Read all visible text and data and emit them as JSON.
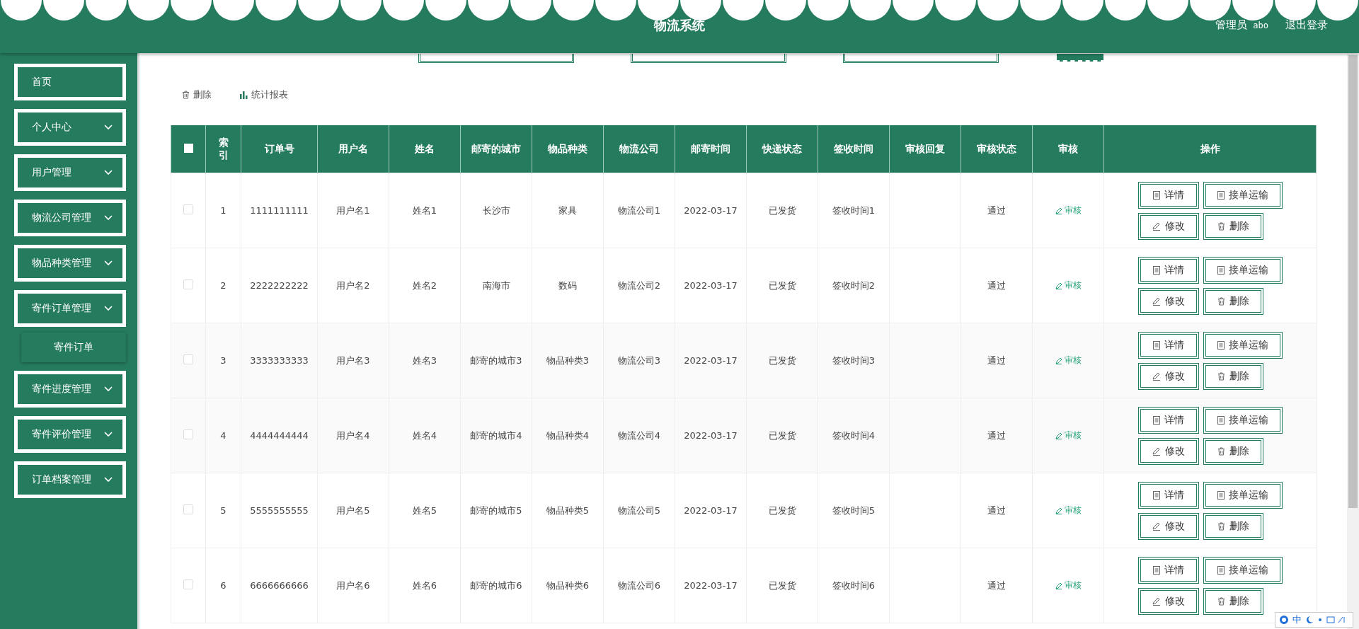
{
  "header": {
    "title": "物流系统",
    "role": "管理员",
    "username": "abo",
    "logout": "退出登录"
  },
  "sidebar": {
    "items": [
      {
        "label": "首页",
        "kind": "link"
      },
      {
        "label": "个人中心",
        "kind": "menu"
      },
      {
        "label": "用户管理",
        "kind": "menu"
      },
      {
        "label": "物流公司管理",
        "kind": "menu"
      },
      {
        "label": "物品种类管理",
        "kind": "menu"
      },
      {
        "label": "寄件订单管理",
        "kind": "menu",
        "children": [
          {
            "label": "寄件订单"
          }
        ]
      },
      {
        "label": "寄件进度管理",
        "kind": "menu"
      },
      {
        "label": "寄件评价管理",
        "kind": "menu"
      },
      {
        "label": "订单档案管理",
        "kind": "menu"
      }
    ]
  },
  "toolbar": [
    {
      "label": "删除",
      "kind": "delete"
    },
    {
      "label": "统计报表",
      "kind": "chart"
    }
  ],
  "table": {
    "select_all": {
      "checked": false
    },
    "columns": [
      "索引",
      "订单号",
      "用户名",
      "姓名",
      "邮寄的城市",
      "物品种类",
      "物流公司",
      "邮寄时间",
      "快递状态",
      "签收时间",
      "审核回复",
      "审核状态",
      "审核",
      "操作"
    ],
    "rows": [
      {
        "selected": false,
        "index": "1",
        "order_no": "1111111111",
        "username": "用户名1",
        "name": "姓名1",
        "city": "长沙市",
        "category": "家具",
        "company": "物流公司1",
        "time": "2022-03-17",
        "status": "已发货",
        "sign_time": "签收时间1",
        "review_status": "通过",
        "review_link": "审核",
        "actions": [
          {
            "label": "详情",
            "kind": "doc"
          },
          {
            "label": "接单运输",
            "kind": "doc"
          },
          {
            "label": "修改",
            "kind": "edit"
          },
          {
            "label": "删除",
            "kind": "delete"
          }
        ]
      },
      {
        "selected": false,
        "index": "2",
        "order_no": "2222222222",
        "username": "用户名2",
        "name": "姓名2",
        "city": "南海市",
        "category": "数码",
        "company": "物流公司2",
        "time": "2022-03-17",
        "status": "已发货",
        "sign_time": "签收时间2",
        "review_status": "通过",
        "review_link": "审核",
        "actions": [
          {
            "label": "详情",
            "kind": "doc"
          },
          {
            "label": "接单运输",
            "kind": "doc"
          },
          {
            "label": "修改",
            "kind": "edit"
          },
          {
            "label": "删除",
            "kind": "delete"
          }
        ]
      },
      {
        "selected": false,
        "index": "3",
        "order_no": "3333333333",
        "username": "用户名3",
        "name": "姓名3",
        "city": "邮寄的城市3",
        "category": "物品种类3",
        "company": "物流公司3",
        "time": "2022-03-17",
        "status": "已发货",
        "sign_time": "签收时间3",
        "review_status": "通过",
        "review_link": "审核",
        "actions": [
          {
            "label": "详情",
            "kind": "doc"
          },
          {
            "label": "接单运输",
            "kind": "doc"
          },
          {
            "label": "修改",
            "kind": "edit"
          },
          {
            "label": "删除",
            "kind": "delete"
          }
        ]
      },
      {
        "selected": false,
        "index": "4",
        "order_no": "4444444444",
        "username": "用户名4",
        "name": "姓名4",
        "city": "邮寄的城市4",
        "category": "物品种类4",
        "company": "物流公司4",
        "time": "2022-03-17",
        "status": "已发货",
        "sign_time": "签收时间4",
        "review_status": "通过",
        "review_link": "审核",
        "actions": [
          {
            "label": "详情",
            "kind": "doc"
          },
          {
            "label": "接单运输",
            "kind": "doc"
          },
          {
            "label": "修改",
            "kind": "edit"
          },
          {
            "label": "删除",
            "kind": "delete"
          }
        ]
      },
      {
        "selected": false,
        "index": "5",
        "order_no": "5555555555",
        "username": "用户名5",
        "name": "姓名5",
        "city": "邮寄的城市5",
        "category": "物品种类5",
        "company": "物流公司5",
        "time": "2022-03-17",
        "status": "已发货",
        "sign_time": "签收时间5",
        "review_status": "通过",
        "review_link": "审核",
        "actions": [
          {
            "label": "详情",
            "kind": "doc"
          },
          {
            "label": "接单运输",
            "kind": "doc"
          },
          {
            "label": "修改",
            "kind": "edit"
          },
          {
            "label": "删除",
            "kind": "delete"
          }
        ]
      },
      {
        "selected": false,
        "index": "6",
        "order_no": "6666666666",
        "username": "用户名6",
        "name": "姓名6",
        "city": "邮寄的城市6",
        "category": "物品种类6",
        "company": "物流公司6",
        "time": "2022-03-17",
        "status": "已发货",
        "sign_time": "签收时间6",
        "review_status": "通过",
        "review_link": "审核",
        "actions": [
          {
            "label": "详情",
            "kind": "doc"
          },
          {
            "label": "接单运输",
            "kind": "doc"
          },
          {
            "label": "修改",
            "kind": "edit"
          },
          {
            "label": "删除",
            "kind": "delete"
          }
        ]
      }
    ]
  },
  "ime": {
    "label": "中"
  }
}
